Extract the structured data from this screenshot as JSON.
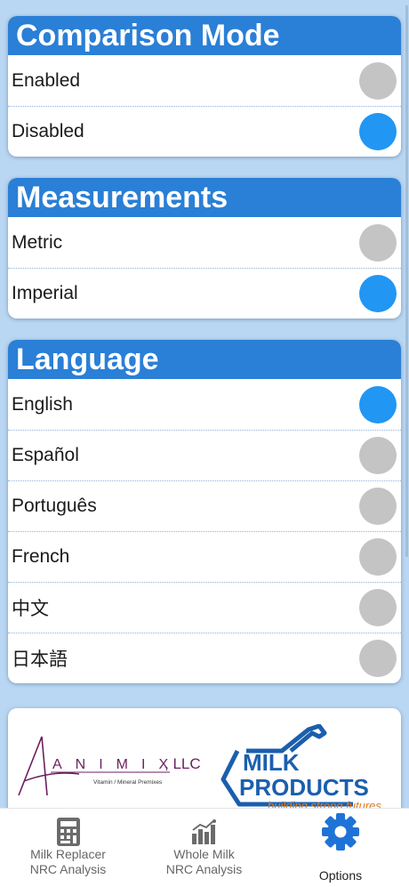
{
  "comparison_mode": {
    "title": "Comparison Mode",
    "options": [
      {
        "label": "Enabled",
        "selected": false
      },
      {
        "label": "Disabled",
        "selected": true
      }
    ]
  },
  "measurements": {
    "title": "Measurements",
    "options": [
      {
        "label": "Metric",
        "selected": false
      },
      {
        "label": "Imperial",
        "selected": true
      }
    ]
  },
  "language": {
    "title": "Language",
    "options": [
      {
        "label": "English",
        "selected": true
      },
      {
        "label": "Español",
        "selected": false
      },
      {
        "label": "Português",
        "selected": false
      },
      {
        "label": "French",
        "selected": false
      },
      {
        "label": "中文",
        "selected": false
      },
      {
        "label": "日本語",
        "selected": false
      }
    ]
  },
  "logos": {
    "animix": {
      "name": "ANIMIX",
      "suffix": ", LLC",
      "tagline": "Vitamin / Mineral Premixes"
    },
    "milk_products": {
      "line1": "MILK",
      "line2": "PRODUCTS",
      "tagline": "building strong futures"
    }
  },
  "tabbar": {
    "tabs": [
      {
        "label_line1": "Milk Replacer",
        "label_line2": "NRC Analysis",
        "icon": "calculator-icon",
        "active": false
      },
      {
        "label_line1": "Whole Milk",
        "label_line2": "NRC Analysis",
        "icon": "bar-chart-icon",
        "active": false
      },
      {
        "label_line1": "Options",
        "label_line2": "",
        "icon": "gear-icon",
        "active": true
      }
    ]
  },
  "colors": {
    "header": "#2a7fd6",
    "radio_on": "#2196f3",
    "radio_off": "#c4c4c4",
    "background": "#b9d7f3",
    "animix_purple": "#6b1f5e",
    "milk_blue": "#1a5fae",
    "milk_orange": "#e07a1f"
  }
}
